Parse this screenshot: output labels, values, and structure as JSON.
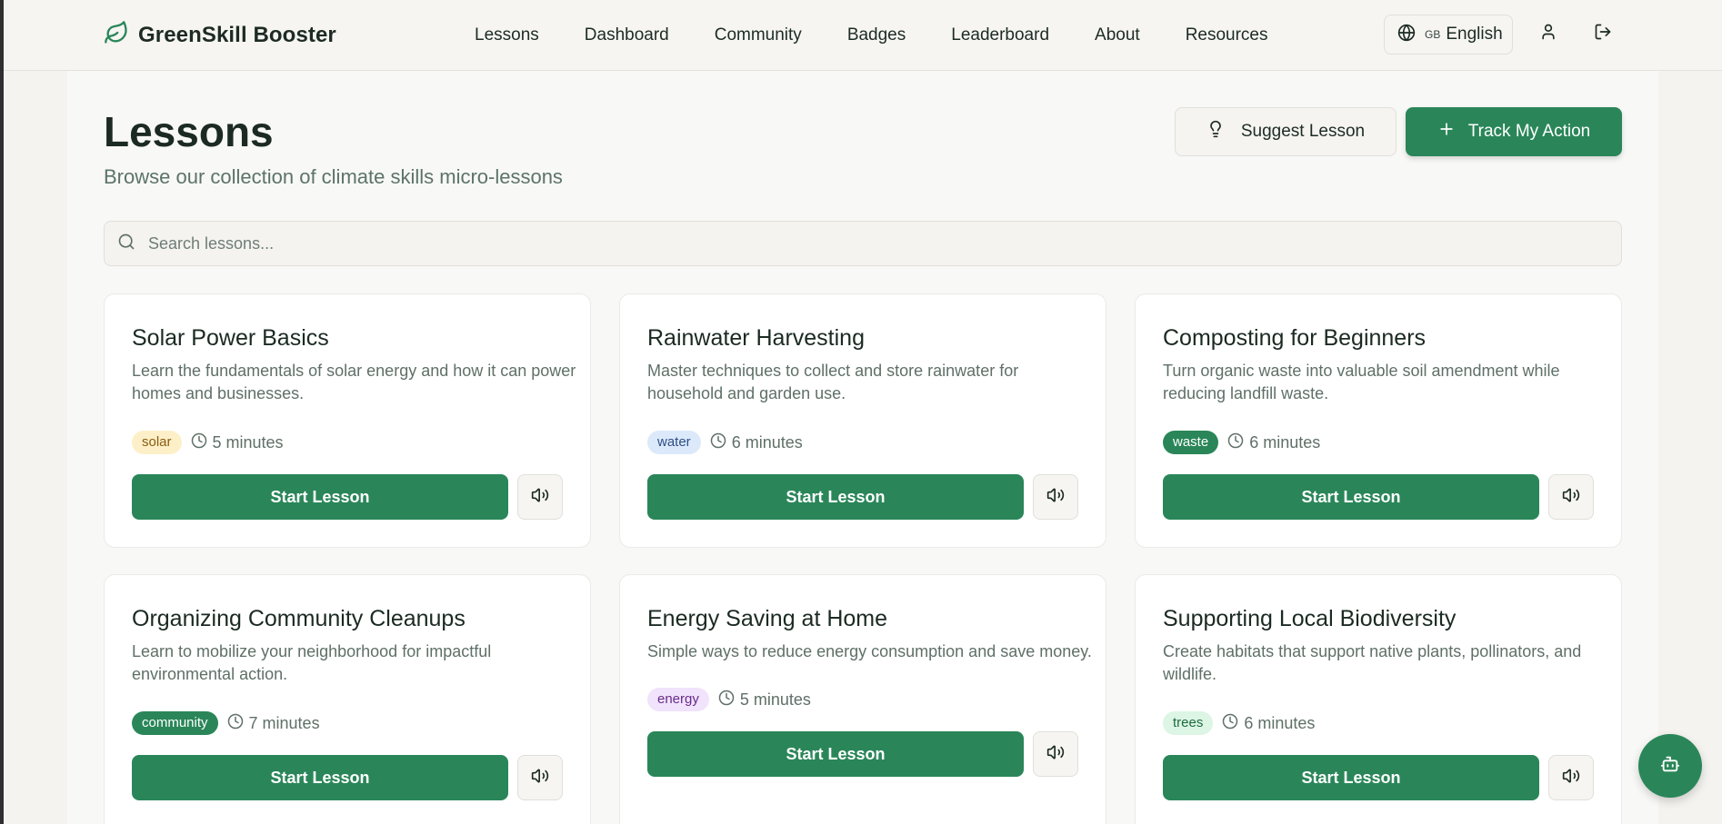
{
  "brand": {
    "name": "GreenSkill Booster",
    "logo_icon": "leaf-icon"
  },
  "nav": {
    "items": [
      {
        "label": "Lessons"
      },
      {
        "label": "Dashboard"
      },
      {
        "label": "Community"
      },
      {
        "label": "Badges"
      },
      {
        "label": "Leaderboard"
      },
      {
        "label": "About"
      },
      {
        "label": "Resources"
      }
    ]
  },
  "header": {
    "language": {
      "flag": "GB",
      "label": "English",
      "icon": "globe-icon"
    },
    "profile_icon": "user-icon",
    "logout_icon": "logout-icon"
  },
  "page": {
    "title": "Lessons",
    "subtitle": "Browse our collection of climate skills micro-lessons",
    "suggest_label": "Suggest Lesson",
    "track_label": "Track My Action"
  },
  "search": {
    "placeholder": "Search lessons...",
    "value": ""
  },
  "lessons": [
    {
      "title": "Solar Power Basics",
      "description": "Learn the fundamentals of solar energy and how it can power homes and businesses.",
      "tag": "solar",
      "duration": "5 minutes",
      "start_label": "Start Lesson"
    },
    {
      "title": "Rainwater Harvesting",
      "description": "Master techniques to collect and store rainwater for household and garden use.",
      "tag": "water",
      "duration": "6 minutes",
      "start_label": "Start Lesson"
    },
    {
      "title": "Composting for Beginners",
      "description": "Turn organic waste into valuable soil amendment while reducing landfill waste.",
      "tag": "waste",
      "duration": "6 minutes",
      "start_label": "Start Lesson"
    },
    {
      "title": "Organizing Community Cleanups",
      "description": "Learn to mobilize your neighborhood for impactful environmental action.",
      "tag": "community",
      "duration": "7 minutes",
      "start_label": "Start Lesson"
    },
    {
      "title": "Energy Saving at Home",
      "description": "Simple ways to reduce energy consumption and save money.",
      "tag": "energy",
      "duration": "5 minutes",
      "start_label": "Start Lesson"
    },
    {
      "title": "Supporting Local Biodiversity",
      "description": "Create habitats that support native plants, pollinators, and wildlife.",
      "tag": "trees",
      "duration": "6 minutes",
      "start_label": "Start Lesson"
    }
  ],
  "colors": {
    "primary": "#2a8659",
    "tag_solar_bg": "#fdf0c8",
    "tag_solar_fg": "#8a5a12",
    "tag_water_bg": "#dce9fb",
    "tag_water_fg": "#2d4f86",
    "tag_waste_bg": "#2a8659",
    "tag_waste_fg": "#ffffff",
    "tag_community_bg": "#2a8659",
    "tag_community_fg": "#ffffff",
    "tag_energy_bg": "#f0e3fb",
    "tag_energy_fg": "#6a2b8a",
    "tag_trees_bg": "#dcf5e4",
    "tag_trees_fg": "#1e6b40"
  },
  "fab": {
    "icon": "bot-icon"
  }
}
